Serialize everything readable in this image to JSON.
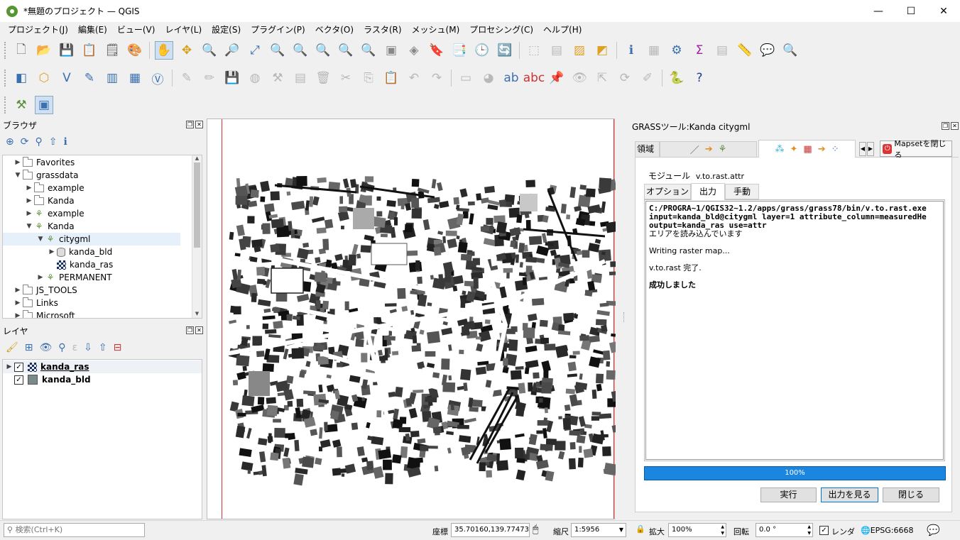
{
  "window": {
    "title": "*無題のプロジェクト — QGIS",
    "minimize": "—",
    "maximize": "☐",
    "close": "✕"
  },
  "menu": [
    "プロジェクト(J)",
    "編集(E)",
    "ビュー(V)",
    "レイヤ(L)",
    "設定(S)",
    "プラグイン(P)",
    "ベクタ(O)",
    "ラスタ(R)",
    "メッシュ(M)",
    "プロセシング(C)",
    "ヘルプ(H)"
  ],
  "browser": {
    "title": "ブラウザ",
    "items": [
      {
        "label": "Favorites",
        "icon": "folder-icon",
        "level": 1,
        "expand": "▶"
      },
      {
        "label": "grassdata",
        "icon": "folder-icon",
        "level": 1,
        "expand": "▼"
      },
      {
        "label": "example",
        "icon": "folder-icon",
        "level": 2,
        "expand": "▶"
      },
      {
        "label": "Kanda",
        "icon": "folder-icon",
        "level": 2,
        "expand": "▶"
      },
      {
        "label": "example",
        "icon": "grass-location-icon",
        "level": 2,
        "expand": "▶"
      },
      {
        "label": "Kanda",
        "icon": "grass-location-icon",
        "level": 2,
        "expand": "▼"
      },
      {
        "label": "citygml",
        "icon": "grass-mapset-icon",
        "level": 3,
        "expand": "▼",
        "selected": true
      },
      {
        "label": "kanda_bld",
        "icon": "vector-db-icon",
        "level": 4,
        "expand": "▶"
      },
      {
        "label": "kanda_ras",
        "icon": "raster-icon",
        "level": 4,
        "expand": ""
      },
      {
        "label": "PERMANENT",
        "icon": "grass-mapset-icon",
        "level": 3,
        "expand": "▶"
      },
      {
        "label": "JS_TOOLS",
        "icon": "folder-icon",
        "level": 1,
        "expand": "▶"
      },
      {
        "label": "Links",
        "icon": "folder-icon",
        "level": 1,
        "expand": "▶"
      },
      {
        "label": "Microsoft",
        "icon": "folder-icon",
        "level": 1,
        "expand": "▶"
      }
    ]
  },
  "layers": {
    "title": "レイヤ",
    "items": [
      {
        "label": "kanda_ras",
        "icon": "raster-icon",
        "checked": "✓",
        "expand": "▶"
      },
      {
        "label": "kanda_bld",
        "icon": "polygon-icon",
        "checked": "✓",
        "expand": ""
      }
    ]
  },
  "grass": {
    "title": "GRASSツール:Kanda citygml",
    "tab_region": "領域",
    "close_mapset": "Mapsetを閉じる",
    "module_label": "モジュール",
    "module_name": "v.to.rast.attr",
    "subtabs": [
      "オプション",
      "出力",
      "手動"
    ],
    "output_lines": [
      {
        "text": "C:/PROGRA~1/QGIS32~1.2/apps/grass/grass78/bin/v.to.rast.exe",
        "bold": true
      },
      {
        "text": "input=kanda_bld@citygml layer=1 attribute_column=measuredHe",
        "bold": true
      },
      {
        "text": "output=kanda_ras use=attr",
        "bold": true
      },
      {
        "text": "エリアを読み込んでいます",
        "bold": false
      },
      {
        "text": "",
        "bold": false
      },
      {
        "text": "Writing raster map...",
        "bold": false
      },
      {
        "text": "",
        "bold": false
      },
      {
        "text": "v.to.rast 完了.",
        "bold": false
      },
      {
        "text": "",
        "bold": false
      },
      {
        "text": "成功しました",
        "bold": true
      }
    ],
    "progress_value": 1.0,
    "progress_text": "100%",
    "run": "実行",
    "view_output": "出力を見る",
    "close": "閉じる"
  },
  "status": {
    "search_placeholder": "検索(Ctrl+K)",
    "coord_label": "座標",
    "coord": "35.70160,139.77473",
    "scale_label": "縮尺",
    "scale": "1:5956",
    "zoom_label": "拡大",
    "zoom": "100%",
    "rotation_label": "回転",
    "rotation": "0.0 °",
    "render_label": "レンダ",
    "crs": "EPSG:6668"
  },
  "colors": {
    "accent": "#0078d7",
    "progress": "#0a78d8",
    "map_frame_line": "#e03030"
  }
}
